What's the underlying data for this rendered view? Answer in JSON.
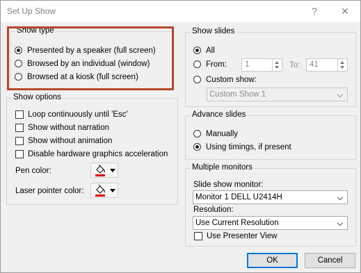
{
  "window": {
    "title": "Set Up Show",
    "help_label": "?",
    "close_label": "✕"
  },
  "show_type": {
    "title": "Show type",
    "options": [
      {
        "label": "Presented by a speaker (full screen)",
        "selected": true
      },
      {
        "label": "Browsed by an individual (window)",
        "selected": false
      },
      {
        "label": "Browsed at a kiosk (full screen)",
        "selected": false
      }
    ]
  },
  "show_options": {
    "title": "Show options",
    "checkboxes": [
      {
        "label": "Loop continuously until 'Esc'",
        "checked": false
      },
      {
        "label": "Show without narration",
        "checked": false
      },
      {
        "label": "Show without animation",
        "checked": false
      },
      {
        "label": "Disable hardware graphics acceleration",
        "checked": false
      }
    ],
    "pen_color_label": "Pen color:",
    "laser_pointer_color_label": "Laser pointer color:",
    "pen_color": "#e00000",
    "laser_color": "#e00000"
  },
  "show_slides": {
    "title": "Show slides",
    "all_label": "All",
    "from_label": "From:",
    "from_value": "1",
    "to_label": "To:",
    "to_value": "41",
    "custom_show_label": "Custom show:",
    "custom_show_value": "Custom Show 1"
  },
  "advance_slides": {
    "title": "Advance slides",
    "manually_label": "Manually",
    "timings_label": "Using timings, if present"
  },
  "multiple_monitors": {
    "title": "Multiple monitors",
    "slide_show_monitor_label": "Slide show monitor:",
    "slide_show_monitor_value": "Monitor 1 DELL U2414H",
    "resolution_label": "Resolution:",
    "resolution_value": "Use Current Resolution",
    "presenter_view_label": "Use Presenter View"
  },
  "buttons": {
    "ok": "OK",
    "cancel": "Cancel"
  },
  "colors": {
    "highlight_border": "#b7472a",
    "accent": "#0078d7"
  }
}
